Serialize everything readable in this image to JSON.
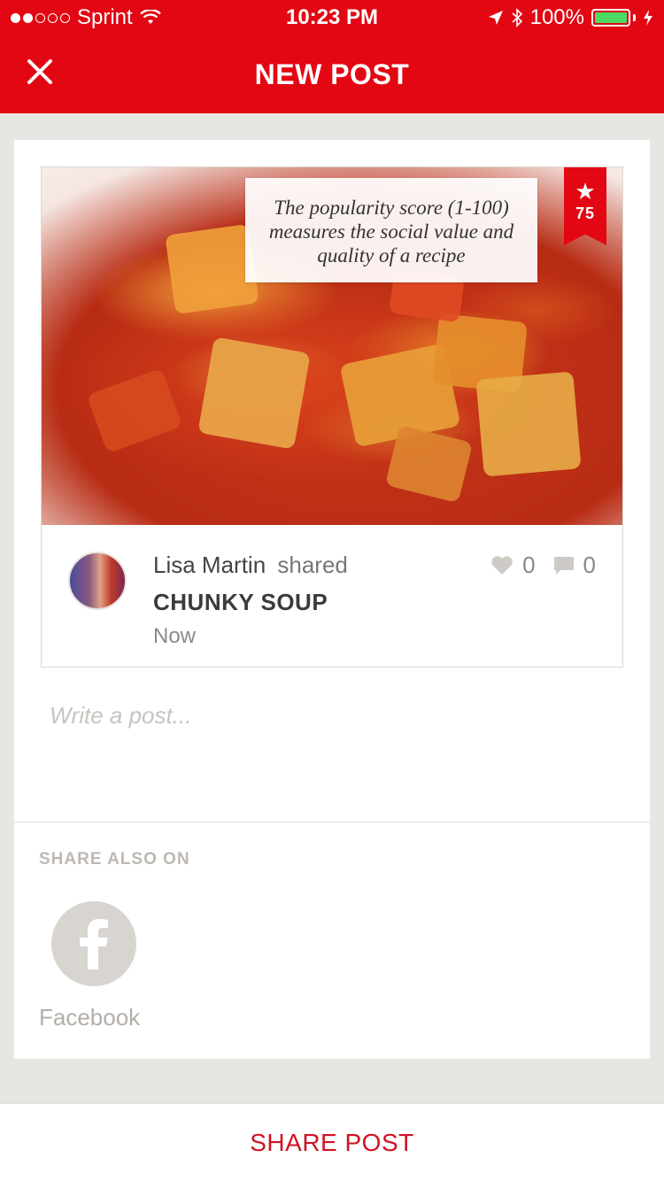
{
  "status_bar": {
    "carrier": "Sprint",
    "time": "10:23 PM",
    "battery": "100%",
    "battery_level": 1.0,
    "icons": [
      "signal-dots-icon",
      "wifi-icon",
      "location-arrow-icon",
      "bluetooth-icon",
      "battery-icon",
      "charging-bolt-icon"
    ]
  },
  "nav": {
    "title": "NEW POST",
    "close_icon": "close-icon"
  },
  "recipe": {
    "popularity_tooltip": "The popularity score (1-100) measures the social value and quality of a recipe",
    "score": "75",
    "author_name": "Lisa Martin",
    "author_action": "shared",
    "title": "CHUNKY SOUP",
    "time": "Now",
    "likes": "0",
    "comments": "0"
  },
  "post": {
    "placeholder": "Write a post..."
  },
  "share_also": {
    "label": "SHARE ALSO ON",
    "networks": [
      {
        "name": "Facebook",
        "icon": "facebook-icon"
      }
    ]
  },
  "actions": {
    "share_post": "SHARE POST"
  },
  "colors": {
    "brand_red": "#e30613",
    "share_text": "#cf1322",
    "battery_green": "#4cd964"
  }
}
